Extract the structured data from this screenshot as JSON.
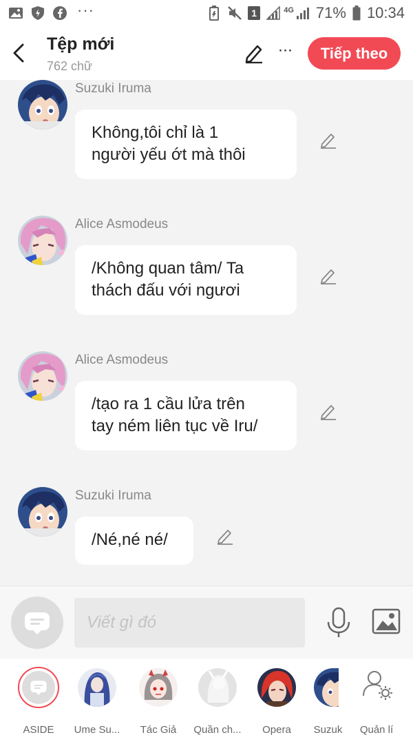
{
  "status_bar": {
    "battery_percent": "71%",
    "time": "10:34",
    "network": "4G",
    "sim_badge": "1",
    "more_dots": "···"
  },
  "header": {
    "title": "Tệp mới",
    "word_count": "762 chữ",
    "more_label": "···",
    "next_label": "Tiếp theo"
  },
  "messages": [
    {
      "sender": "Suzuki Iruma",
      "text_lines": [
        "Không,tôi chỉ là 1",
        "người yếu ớt mà thôi"
      ],
      "avatar": "suzuki-iruma"
    },
    {
      "sender": "Alice Asmodeus",
      "text_lines": [
        "/Không quan tâm/ Ta",
        "thách đấu với ngươi"
      ],
      "avatar": "alice-asmodeus"
    },
    {
      "sender": "Alice Asmodeus",
      "text_lines": [
        "/tạo ra 1 cầu lửa trên",
        "tay ném liên tục về Iru/"
      ],
      "avatar": "alice-asmodeus"
    },
    {
      "sender": "Suzuki Iruma",
      "text_lines": [
        "/Né,né né/"
      ],
      "avatar": "suzuki-iruma"
    }
  ],
  "input": {
    "placeholder": "Viết gì đó"
  },
  "characters": [
    {
      "label": "ASIDE",
      "selected": true
    },
    {
      "label": "Ume Su..."
    },
    {
      "label": "Tác Giả"
    },
    {
      "label": "Quần ch..."
    },
    {
      "label": "Opera"
    },
    {
      "label": "Suzuk"
    },
    {
      "label": "Quản lí"
    }
  ],
  "colors": {
    "accent": "#f24a55",
    "background": "#f3f3f3"
  }
}
